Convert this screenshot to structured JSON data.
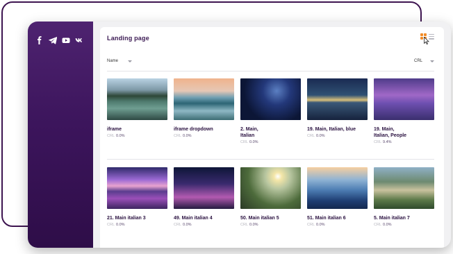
{
  "sidebar": {
    "social": [
      {
        "name": "facebook-icon"
      },
      {
        "name": "telegram-icon"
      },
      {
        "name": "youtube-icon"
      },
      {
        "name": "vk-icon"
      }
    ]
  },
  "panel": {
    "title": "Landing page",
    "sort_name_label": "Name",
    "sort_crl_label": "CRL"
  },
  "crl_label": "CRL",
  "rows": [
    [
      {
        "title": "iframe",
        "crl": "0.0%"
      },
      {
        "title": "iframe dropdown",
        "crl": "0.0%"
      },
      {
        "title": "2. Main,\nItalian",
        "crl": "0.0%"
      },
      {
        "title": "19. Main, Italian, blue",
        "crl": "0.0%"
      },
      {
        "title": "19. Main,\nItalian, People",
        "crl": "9.4%"
      }
    ],
    [
      {
        "title": "21. Main italian 3",
        "crl": "0.0%"
      },
      {
        "title": "49. Main italian 4",
        "crl": "0.0%"
      },
      {
        "title": "50. Main italian 5",
        "crl": "0.0%"
      },
      {
        "title": "51. Main italian 6",
        "crl": "0.0%"
      },
      {
        "title": "5. Main italian 7",
        "crl": "0.0%"
      }
    ]
  ],
  "colors": {
    "accent": "#f28c28",
    "sidebar": "#3c155c",
    "title": "#3a1852"
  }
}
